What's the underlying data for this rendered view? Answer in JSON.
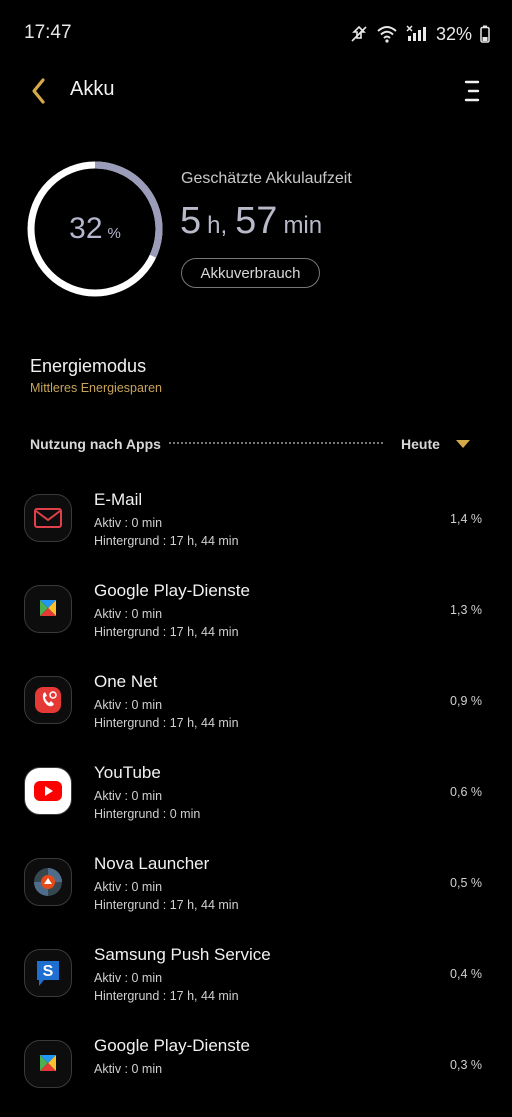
{
  "status_bar": {
    "time": "17:47",
    "battery_text": "32%"
  },
  "header": {
    "title": "Akku"
  },
  "battery": {
    "percent_value": "32",
    "percent_unit": "%",
    "level_fraction": 0.32,
    "estimated_label": "Geschätzte Akkulaufzeit",
    "hours": "5",
    "hours_unit": "h,",
    "minutes": "57",
    "minutes_unit": "min",
    "usage_button": "Akkuverbrauch"
  },
  "energy_mode": {
    "title": "Energiemodus",
    "value": "Mittleres Energiesparen"
  },
  "usage": {
    "label": "Nutzung nach Apps",
    "period": "Heute"
  },
  "apps": [
    {
      "name": "E-Mail",
      "active": "Aktiv : 0 min",
      "background": "Hintergrund : 17 h, 44 min",
      "percent": "1,4 %",
      "icon": "email-icon"
    },
    {
      "name": "Google Play-Dienste",
      "active": "Aktiv : 0 min",
      "background": "Hintergrund : 17 h, 44 min",
      "percent": "1,3 %",
      "icon": "google-play-services-icon"
    },
    {
      "name": "One Net",
      "active": "Aktiv : 0 min",
      "background": "Hintergrund : 17 h, 44 min",
      "percent": "0,9 %",
      "icon": "one-net-icon"
    },
    {
      "name": "YouTube",
      "active": "Aktiv : 0 min",
      "background": "Hintergrund : 0 min",
      "percent": "0,6 %",
      "icon": "youtube-icon"
    },
    {
      "name": "Nova Launcher",
      "active": "Aktiv : 0 min",
      "background": "Hintergrund : 17 h, 44 min",
      "percent": "0,5 %",
      "icon": "nova-launcher-icon"
    },
    {
      "name": "Samsung Push Service",
      "active": "Aktiv : 0 min",
      "background": "Hintergrund : 17 h, 44 min",
      "percent": "0,4 %",
      "icon": "samsung-push-icon"
    },
    {
      "name": "Google Play-Dienste",
      "active": "Aktiv : 0 min",
      "background": "",
      "percent": "0,3 %",
      "icon": "google-play-services-icon"
    }
  ]
}
